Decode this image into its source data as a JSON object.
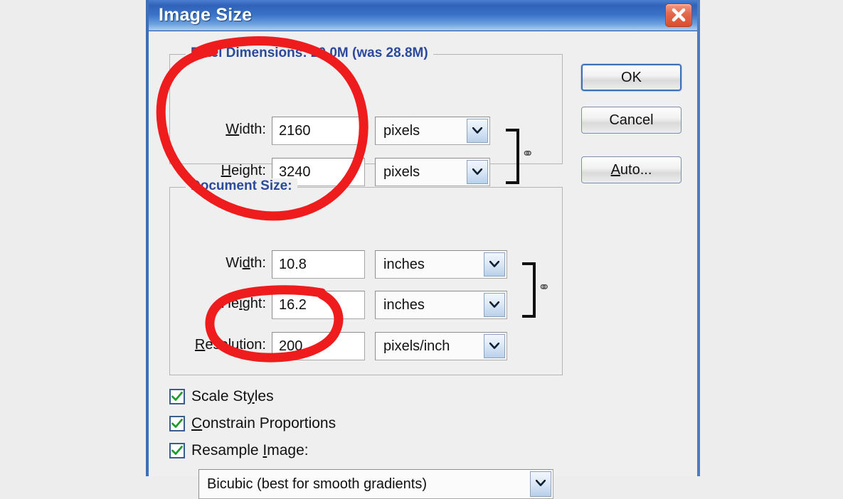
{
  "window": {
    "title": "Image Size",
    "close_icon": "close-x-icon"
  },
  "pixel_dimensions": {
    "group_label": "Pixel Dimensions:  20.0M (was 28.8M)",
    "width": {
      "label_pre": "",
      "label_key": "W",
      "label_post": "idth:",
      "value": "2160",
      "unit": "pixels"
    },
    "height": {
      "label_pre": "",
      "label_key": "H",
      "label_post": "eight:",
      "value": "3240",
      "unit": "pixels"
    },
    "link_icon": "chain-link-icon"
  },
  "document_size": {
    "group_label": "Document Size:",
    "width": {
      "label_pre": "Wi",
      "label_key": "d",
      "label_post": "th:",
      "value": "10.8",
      "unit": "inches"
    },
    "height": {
      "label_pre": "He",
      "label_key": "i",
      "label_post": "ght:",
      "value": "16.2",
      "unit": "inches"
    },
    "resolution": {
      "label_pre": "",
      "label_key": "R",
      "label_post": "esolution:",
      "value": "200",
      "unit": "pixels/inch"
    },
    "link_icon": "chain-link-icon"
  },
  "options": {
    "scale_styles": {
      "label_pre": "Scale St",
      "label_key": "y",
      "label_post": "les",
      "checked": true
    },
    "constrain_proportions": {
      "label_pre": "",
      "label_key": "C",
      "label_post": "onstrain Proportions",
      "checked": true
    },
    "resample_image": {
      "label_pre": "Resample ",
      "label_key": "I",
      "label_post": "mage:",
      "checked": true
    },
    "resample_method": "Bicubic (best for smooth gradients)"
  },
  "buttons": {
    "ok": "OK",
    "cancel": "Cancel",
    "auto_pre": "A",
    "auto_key": "A",
    "auto_post": "uto..."
  },
  "colors": {
    "titlebar_blue": "#3a72c7",
    "group_label_blue": "#2b4a9b",
    "annotation_red": "#ee1c1c",
    "check_green": "#1f9c2e",
    "close_red": "#e3674a"
  },
  "annotations": [
    {
      "name": "pixel-dimensions-circle",
      "shape": "ellipse"
    },
    {
      "name": "resolution-circle",
      "shape": "ellipse"
    }
  ]
}
